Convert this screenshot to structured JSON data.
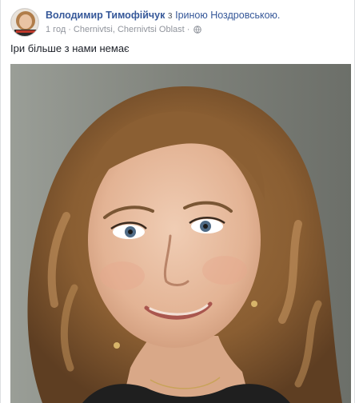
{
  "post": {
    "author": "Володимир Тимофійчук",
    "with_word": "з",
    "tagged": "Іриною Ноздровською.",
    "time": "1 год",
    "dot": "·",
    "location": "Chernivtsi, Chernivtsi Oblast",
    "privacy_icon": "globe-icon",
    "text": "Іри більше з нами немає",
    "photo_icon": "portrait-photo"
  },
  "colors": {
    "link": "#365899",
    "meta": "#90949c",
    "text": "#1d2129"
  }
}
